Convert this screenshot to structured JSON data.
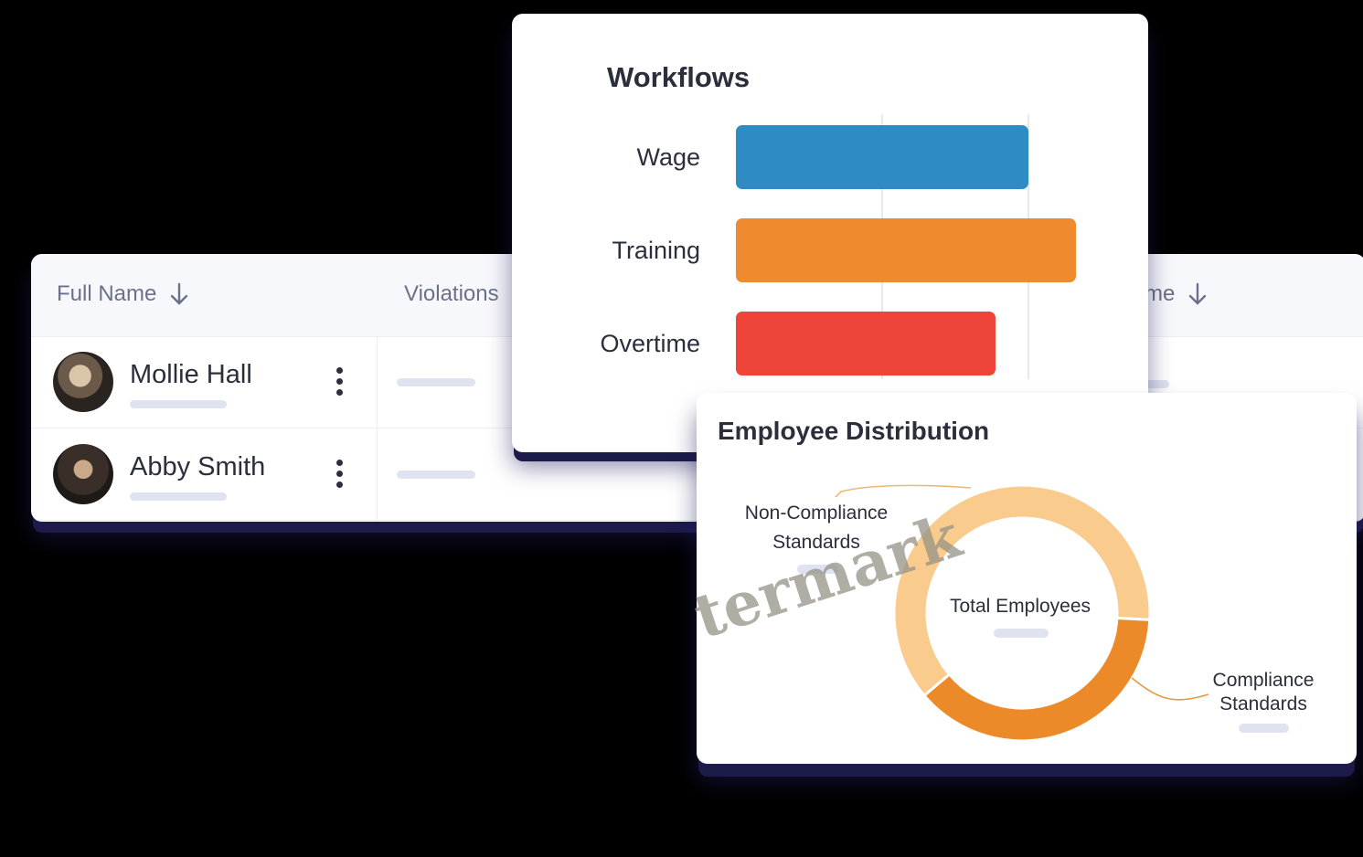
{
  "table": {
    "columns": [
      "Full Name",
      "Violations",
      "rtime"
    ],
    "rows": [
      {
        "name": "Mollie Hall"
      },
      {
        "name": "Abby Smith"
      }
    ]
  },
  "workflows": {
    "title": "Workflows"
  },
  "distribution": {
    "title": "Employee Distribution",
    "center_label": "Total Employees",
    "label_noncompliance": "Non-Compliance Standards",
    "label_compliance": "Compliance Standards"
  },
  "watermark": "termark",
  "colors": {
    "wage": "#2f8bc4",
    "training": "#ef8a2f",
    "overtime": "#ee443a",
    "donut_light": "#f9cb8c",
    "donut_dark": "#ec8a2a"
  },
  "chart_data": [
    {
      "type": "bar",
      "orientation": "horizontal",
      "title": "Workflows",
      "categories": [
        "Wage",
        "Training",
        "Overtime"
      ],
      "values": [
        80,
        93,
        71
      ],
      "xlim": [
        0,
        100
      ],
      "grid": true
    },
    {
      "type": "pie",
      "style": "donut",
      "title": "Employee Distribution",
      "center_label": "Total Employees",
      "categories": [
        "Non-Compliance Standards",
        "Compliance Standards"
      ],
      "values": [
        62,
        38
      ]
    }
  ]
}
